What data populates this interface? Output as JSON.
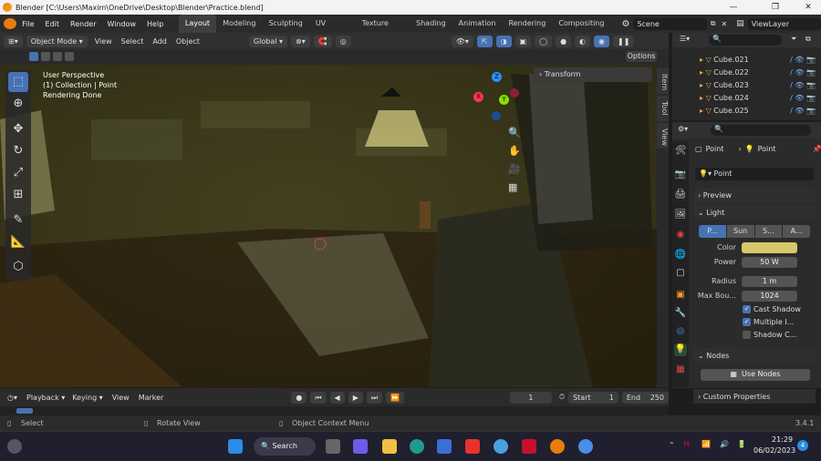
{
  "titlebar": {
    "title": "Blender [C:\\Users\\Maxim\\OneDrive\\Desktop\\Blender\\Practice.blend]",
    "minimize": "—",
    "maximize": "❐",
    "close": "✕"
  },
  "menu": {
    "items": [
      "File",
      "Edit",
      "Render",
      "Window",
      "Help"
    ]
  },
  "workspaces": [
    "Layout",
    "Modeling",
    "Sculpting",
    "UV Editing",
    "Texture Paint",
    "Shading",
    "Animation",
    "Rendering",
    "Compositing"
  ],
  "scene": "Scene",
  "view_layer": "ViewLayer",
  "header": {
    "mode": "Object Mode",
    "view": "View",
    "select": "Select",
    "add": "Add",
    "object": "Object",
    "transform_orientation": "Global",
    "options": "Options"
  },
  "viewport": {
    "overlay_lines": [
      "User Perspective",
      "(1) Collection | Point",
      "Rendering Done"
    ],
    "transform_panel": "Transform"
  },
  "gizmo": {
    "x": "X",
    "y": "Y",
    "z": "Z"
  },
  "npanel_tabs": [
    "Item",
    "Tool",
    "View"
  ],
  "outliner": {
    "items": [
      "Cube.021",
      "Cube.022",
      "Cube.023",
      "Cube.024",
      "Cube.025"
    ]
  },
  "props": {
    "breadcrumb_obj": "Point",
    "breadcrumb_data": "Point",
    "datablock": "Point",
    "sections": {
      "preview": "Preview",
      "light": "Light",
      "nodes": "Nodes",
      "custom": "Custom Properties"
    },
    "light_types": [
      "P...",
      "Sun",
      "S...",
      "A..."
    ],
    "color_label": "Color",
    "color_value": "#d6c96a",
    "power_label": "Power",
    "power_value": "50 W",
    "radius_label": "Radius",
    "radius_value": "1 m",
    "maxb_label": "Max Bou...",
    "maxb_value": "1024",
    "cast_shadow": "Cast Shadow",
    "multiple": "Multiple I...",
    "shadow_c": "Shadow C...",
    "use_nodes": "Use Nodes"
  },
  "timeline": {
    "playback": "Playback",
    "keying": "Keying",
    "view": "View",
    "marker": "Marker",
    "current_frame": "1",
    "start_label": "Start",
    "start": "1",
    "end_label": "End",
    "end": "250"
  },
  "status": {
    "select": "Select",
    "rotate": "Rotate View",
    "context": "Object Context Menu",
    "version": "3.4.1"
  },
  "taskbar": {
    "search": "Search",
    "time": "21:29",
    "date": "06/02/2023",
    "notif": "4"
  }
}
